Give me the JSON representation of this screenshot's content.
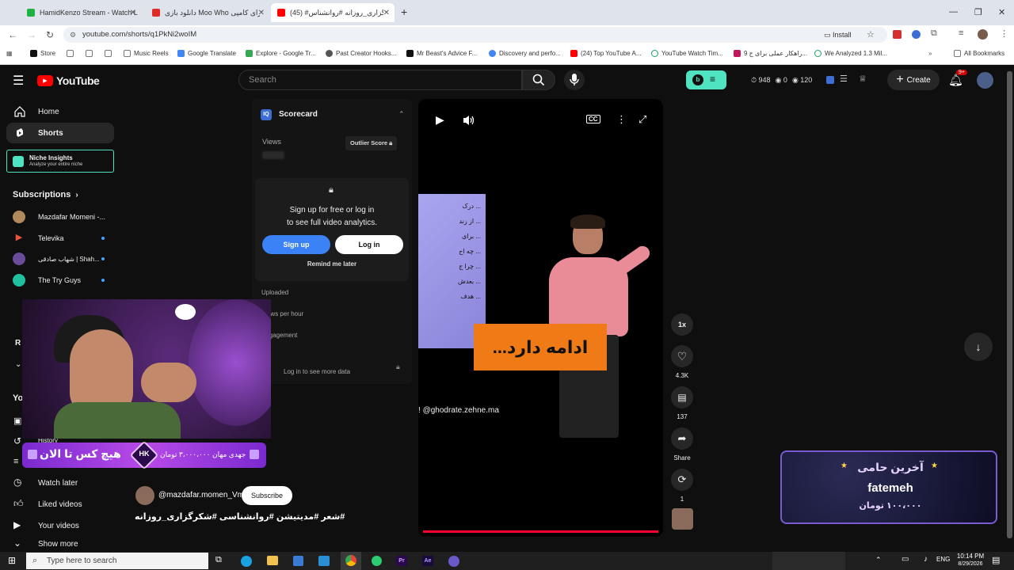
{
  "browser": {
    "tabs": [
      {
        "title": "HamidKenzo Stream - Watch L",
        "active": false,
        "color": "#1fb141"
      },
      {
        "title": "دانلود بازی Moo Who برای کامپی",
        "active": false,
        "color": "#e02b2b"
      },
      {
        "title": "(45) #شکرگزاری_روزانه #روانشناس",
        "active": true,
        "color": "#ff0000"
      }
    ],
    "url": "youtube.com/shorts/q1PkNi2woIM",
    "install_label": "Install",
    "bookmarks": [
      {
        "label": "Store",
        "color": "#111"
      },
      {
        "label": "",
        "color": "#777"
      },
      {
        "label": "",
        "color": "#777"
      },
      {
        "label": "Music Reels",
        "color": "#777"
      },
      {
        "label": "Google Translate",
        "color": "#4285f4"
      },
      {
        "label": "Explore - Google Tr...",
        "color": "#34a853"
      },
      {
        "label": "Past Creator Hooks...",
        "color": "#555"
      },
      {
        "label": "Mr Beast's Advice F...",
        "color": "#111"
      },
      {
        "label": "Discovery and perfo...",
        "color": "#4285f4"
      },
      {
        "label": "(24) Top YouTube A...",
        "color": "#ff0000"
      },
      {
        "label": "YouTube Watch Tim...",
        "color": "#1ea362"
      },
      {
        "label": "9 راهکار عملی برای ج...",
        "color": "#c2185b"
      },
      {
        "label": "We Analyzed 1.3 Mil...",
        "color": "#1ea362"
      }
    ],
    "all_bookmarks": "All Bookmarks"
  },
  "youtube": {
    "logo": "YouTube",
    "search_placeholder": "Search",
    "stats": {
      "a": "948",
      "b": "0",
      "c": "120"
    },
    "create_label": "Create",
    "notif_badge": "9+",
    "sidebar": {
      "home": "Home",
      "shorts": "Shorts",
      "niche_title": "Niche Insights",
      "niche_sub": "Analyze your entire niche",
      "subscriptions": "Subscriptions",
      "subs": [
        {
          "name": "Mazdafar Momeni -...",
          "color": "#b08a5c",
          "dot": false
        },
        {
          "name": "Televika",
          "color": "#e6553a",
          "dot": true
        },
        {
          "name": "شهاب صادقی | Shah...",
          "color": "#6a4c9c",
          "dot": true
        },
        {
          "name": "The Try Guys",
          "color": "#20c0a0",
          "dot": true
        }
      ],
      "you_letter": "Yo",
      "history": "History",
      "watch_later": "Watch later",
      "liked": "Liked videos",
      "your_videos": "Your videos",
      "show_more": "Show more"
    },
    "scorecard": {
      "title": "Scorecard",
      "views_label": "Views",
      "outlier_label": "Outlier Score",
      "signup_text_1": "Sign up for free or log in",
      "signup_text_2": "to see full video analytics.",
      "signup_btn": "Sign up",
      "login_btn": "Log in",
      "remind": "Remind me later",
      "uploaded": "Uploaded",
      "views_per_hour": "Views per hour",
      "engagement": "Engagement",
      "login_more": "Log in to see more data"
    },
    "video": {
      "overlay_text": "ادامه دارد...",
      "watermark": "@ghodrate.zehne.ma",
      "slide_lines": [
        "... درک",
        "... از زند",
        "... برای",
        "... چه اح",
        "... چرا ج",
        "... بعدش",
        "... هدف"
      ]
    },
    "actions": {
      "speed": "1x",
      "likes": "4.3K",
      "comments": "137",
      "share": "Share",
      "remix": "1"
    },
    "channel": {
      "handle": "@mazdafar.momen_Vm",
      "subscribe": "Subscribe",
      "hashtags": "#شعر #مدیتیشن #روانشناسی #شکرگزاری_روزانه"
    }
  },
  "stream_overlay": {
    "donation_line": "جهدی مهان ۳،۰۰۰،۰۰۰ تومان",
    "message": "هیچ کس تا الان",
    "hk_logo": "HK",
    "top_donor_title": "آخرین حامی",
    "top_donor_name": "fatemeh",
    "top_donor_amount": "۱۰۰،۰۰۰ تومان"
  },
  "taskbar": {
    "search_placeholder": "Type here to search",
    "lang": "ENG",
    "time": "10:14 PM",
    "date": "8/29/2026"
  }
}
